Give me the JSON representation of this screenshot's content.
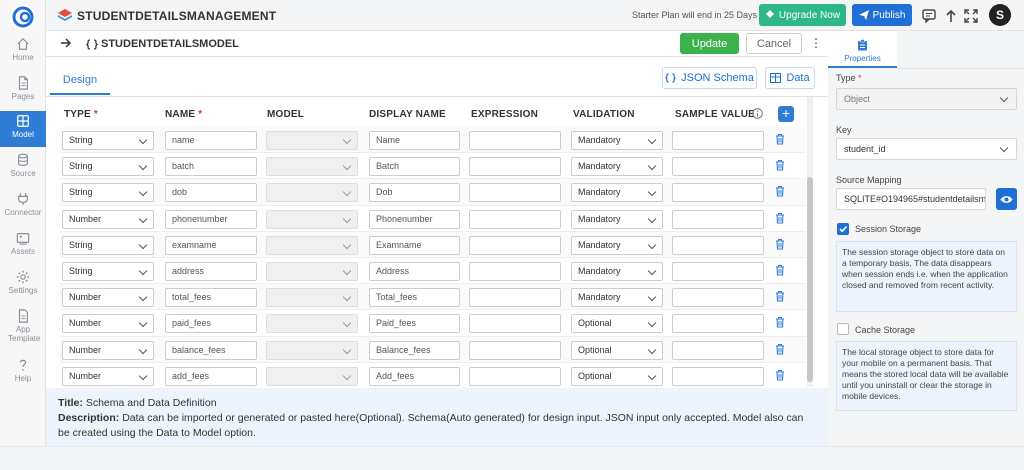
{
  "nav": [
    {
      "label": "Home",
      "icon": "home-icon"
    },
    {
      "label": "Pages",
      "icon": "pages-icon"
    },
    {
      "label": "Model",
      "icon": "model-icon"
    },
    {
      "label": "Source",
      "icon": "database-icon"
    },
    {
      "label": "Connector",
      "icon": "plug-icon"
    },
    {
      "label": "Assets",
      "icon": "image-icon"
    },
    {
      "label": "Settings",
      "icon": "gear-icon"
    },
    {
      "label": "App Template",
      "icon": "template-icon"
    },
    {
      "label": "Help",
      "icon": "help-icon"
    }
  ],
  "header": {
    "app_name": "STUDENTDETAILSMANAGEMENT",
    "plan_text": "Starter Plan will end in 25 Days",
    "upgrade_label": "Upgrade Now",
    "publish_label": "Publish",
    "avatar_letter": "S"
  },
  "modelbar": {
    "title": "STUDENTDETAILSMODEL",
    "update_label": "Update",
    "cancel_label": "Cancel"
  },
  "tabs": {
    "design": "Design",
    "json_schema": "JSON Schema",
    "data": "Data"
  },
  "columns": {
    "type": "TYPE",
    "name": "NAME",
    "model": "MODEL",
    "display_name": "DISPLAY NAME",
    "expression": "EXPRESSION",
    "validation": "VALIDATION",
    "sample_value": "SAMPLE VALUE"
  },
  "rows": [
    {
      "type": "String",
      "name": "name",
      "display": "Name",
      "validation": "Mandatory"
    },
    {
      "type": "String",
      "name": "batch",
      "display": "Batch",
      "validation": "Mandatory"
    },
    {
      "type": "String",
      "name": "dob",
      "display": "Dob",
      "validation": "Mandatory"
    },
    {
      "type": "Number",
      "name": "phonenumber",
      "display": "Phonenumber",
      "validation": "Mandatory"
    },
    {
      "type": "String",
      "name": "examname",
      "display": "Examname",
      "validation": "Mandatory"
    },
    {
      "type": "String",
      "name": "address",
      "display": "Address",
      "validation": "Mandatory"
    },
    {
      "type": "Number",
      "name": "total_fees",
      "display": "Total_fees",
      "validation": "Mandatory"
    },
    {
      "type": "Number",
      "name": "paid_fees",
      "display": "Paid_fees",
      "validation": "Optional"
    },
    {
      "type": "Number",
      "name": "balance_fees",
      "display": "Balance_fees",
      "validation": "Optional"
    },
    {
      "type": "Number",
      "name": "add_fees",
      "display": "Add_fees",
      "validation": "Optional"
    }
  ],
  "info": {
    "title_label": "Title:",
    "title_value": "Schema and Data Definition",
    "desc_label": "Description:",
    "desc_value": "Data can be imported or generated or pasted here(Optional). Schema(Auto generated) for design input. JSON input only accepted. Model also can be created using the Data to Model option."
  },
  "properties": {
    "tab_label": "Properties",
    "type_label": "Type",
    "type_value": "Object",
    "key_label": "Key",
    "key_value": "student_id",
    "source_mapping_label": "Source Mapping",
    "source_mapping_value": "SQLITE#O194965#studentdetailsm",
    "session_label": "Session Storage",
    "session_checked": true,
    "session_desc": "The session storage object to store data on a temporary basis, The data disappears when session ends i.e. when the application closed and removed from recent activity.",
    "cache_label": "Cache Storage",
    "cache_checked": false,
    "cache_desc": "The local storage object to store data for your mobile on a permanent basis. That means the stored local data will be available until you uninstall or clear the storage in mobile devices."
  },
  "colors": {
    "accent": "#2f7dd7",
    "upgrade": "#2eb88a",
    "publish": "#1f6fd6",
    "update": "#3cb34a"
  }
}
